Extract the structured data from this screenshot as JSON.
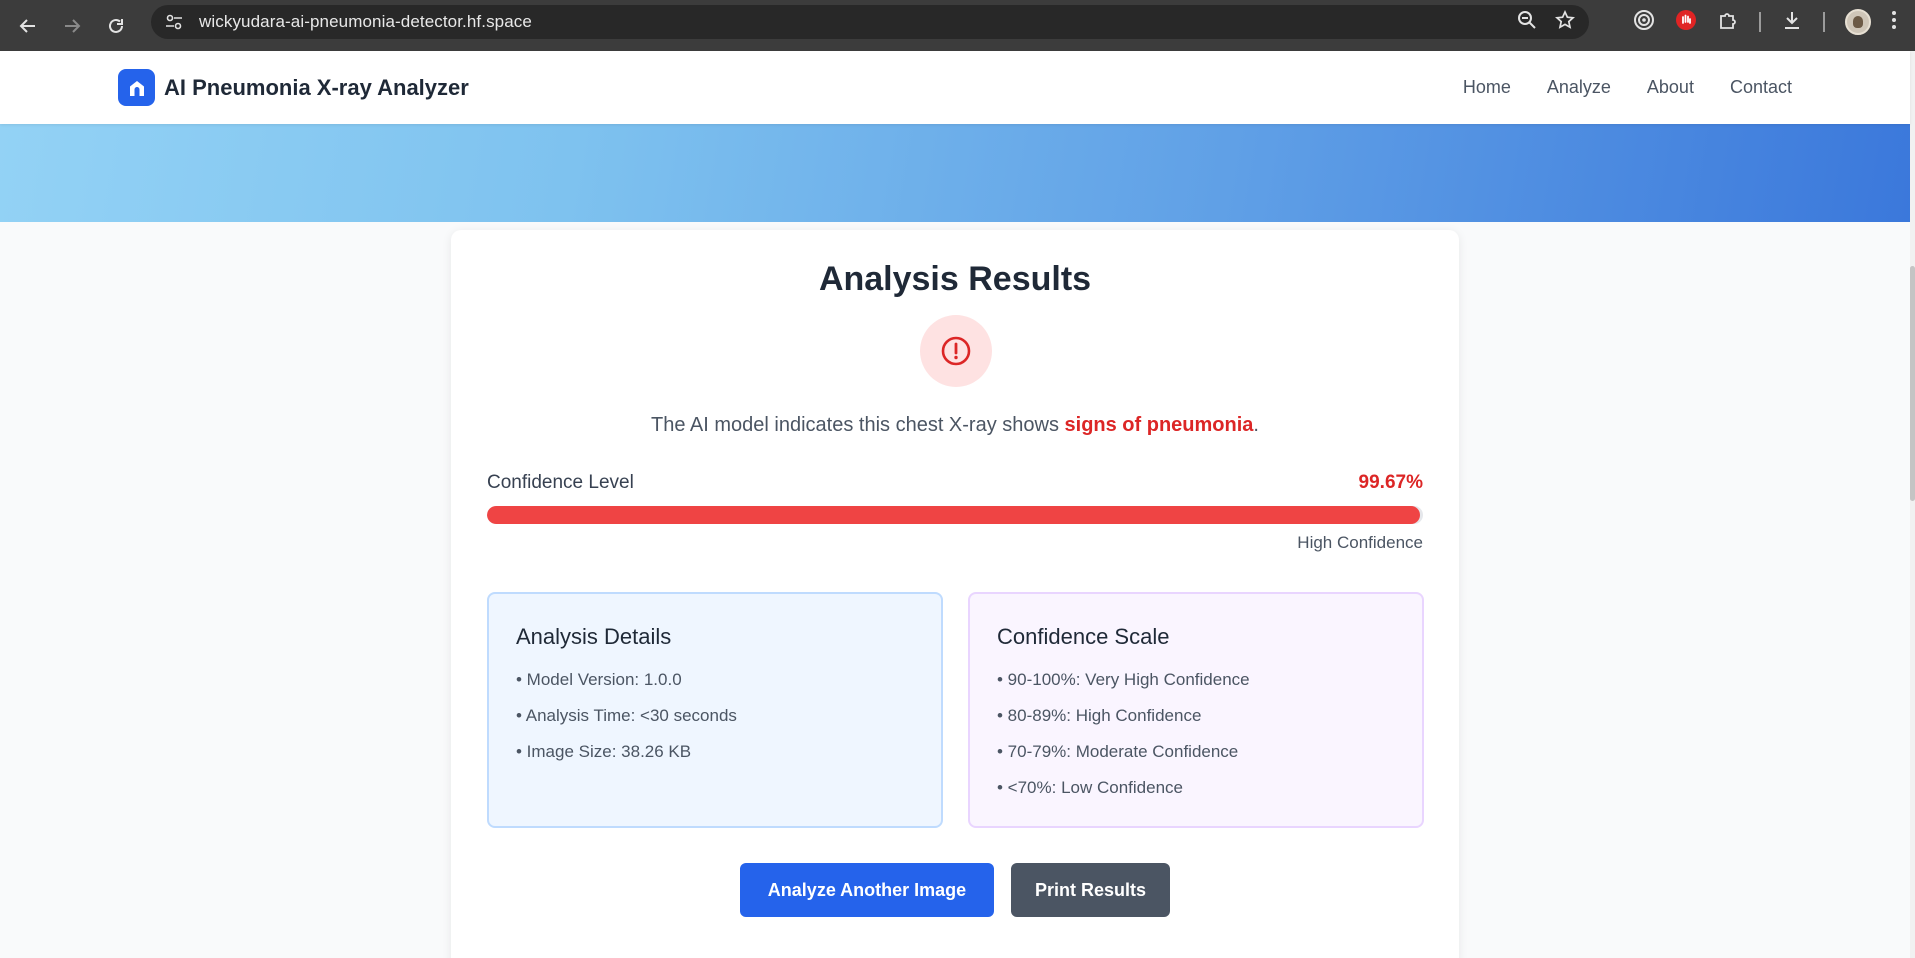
{
  "browser": {
    "url": "wickyudara-ai-pneumonia-detector.hf.space",
    "icons": [
      "back-icon",
      "forward-icon",
      "reload-icon",
      "site-info-icon",
      "zoom-icon",
      "bookmark-star-icon",
      "extension-target-icon",
      "extension-stop-icon",
      "extensions-puzzle-icon",
      "download-icon",
      "profile-avatar-icon",
      "menu-dots-icon"
    ]
  },
  "header": {
    "brand_title": "AI Pneumonia X-ray Analyzer",
    "nav": [
      "Home",
      "Analyze",
      "About",
      "Contact"
    ]
  },
  "results": {
    "title": "Analysis Results",
    "verdict_prefix": "The AI model indicates this chest X-ray shows ",
    "verdict_highlight": "signs of pneumonia",
    "verdict_suffix": ".",
    "confidence_label": "Confidence Level",
    "confidence_value": "99.67%",
    "confidence_fraction": 0.9967,
    "confidence_desc": "High Confidence"
  },
  "details": {
    "title": "Analysis Details",
    "items": [
      "• Model Version: 1.0.0",
      "• Analysis Time: <30 seconds",
      "• Image Size: 38.26 KB"
    ]
  },
  "scale": {
    "title": "Confidence Scale",
    "items": [
      "• 90-100%: Very High Confidence",
      "• 80-89%: High Confidence",
      "• 70-79%: Moderate Confidence",
      "• <70%: Low Confidence"
    ]
  },
  "actions": {
    "analyze_another": "Analyze Another Image",
    "print": "Print Results"
  },
  "colors": {
    "primary": "#2563eb",
    "danger": "#dc2626",
    "bar_fill": "#ef4444",
    "secondary_button": "#4b5563"
  }
}
